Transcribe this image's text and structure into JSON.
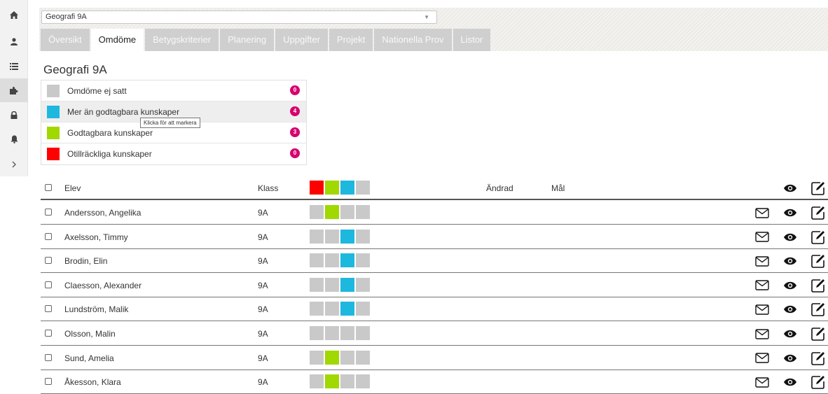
{
  "colors": {
    "red": "#ff0000",
    "green": "#a0d800",
    "blue": "#1eb8de",
    "grey": "#c9c9c9",
    "badge": "#d6006f"
  },
  "rail": [
    "home-icon",
    "user-icon",
    "list-icon",
    "puzzle-icon",
    "lock-icon",
    "bell-icon",
    "chevron-right-icon"
  ],
  "course_select": {
    "value": "Geografi 9A"
  },
  "tabs": [
    "Översikt",
    "Omdöme",
    "Betygskriterier",
    "Planering",
    "Uppgifter",
    "Projekt",
    "Nationella Prov",
    "Listor"
  ],
  "active_tab": "Omdöme",
  "page_title": "Geografi 9A",
  "legend": [
    {
      "label": "Omdöme ej satt",
      "count": "0",
      "color": "#c9c9c9"
    },
    {
      "label": "Mer än godtagbara kunskaper",
      "count": "4",
      "color": "#1eb8de"
    },
    {
      "label": "Godtagbara kunskaper",
      "count": "3",
      "color": "#a0d800"
    },
    {
      "label": "Otillräckliga kunskaper",
      "count": "0",
      "color": "#ff0000"
    }
  ],
  "tooltip": "Klicka för att markera",
  "table": {
    "headers": {
      "student": "Elev",
      "class": "Klass",
      "changed": "Ändrad",
      "goal": "Mål"
    },
    "header_grade_colors": [
      "#ff0000",
      "#a0d800",
      "#1eb8de",
      "#c9c9c9"
    ],
    "rows": [
      {
        "name": "Andersson, Angelika",
        "class": "9A",
        "grade": "green"
      },
      {
        "name": "Axelsson, Timmy",
        "class": "9A",
        "grade": "blue"
      },
      {
        "name": "Brodin, Elin",
        "class": "9A",
        "grade": "blue"
      },
      {
        "name": "Claesson, Alexander",
        "class": "9A",
        "grade": "blue"
      },
      {
        "name": "Lundström, Malik",
        "class": "9A",
        "grade": "blue"
      },
      {
        "name": "Olsson, Malin",
        "class": "9A",
        "grade": "none"
      },
      {
        "name": "Sund, Amelia",
        "class": "9A",
        "grade": "green"
      },
      {
        "name": "Åkesson, Klara",
        "class": "9A",
        "grade": "green"
      }
    ]
  }
}
